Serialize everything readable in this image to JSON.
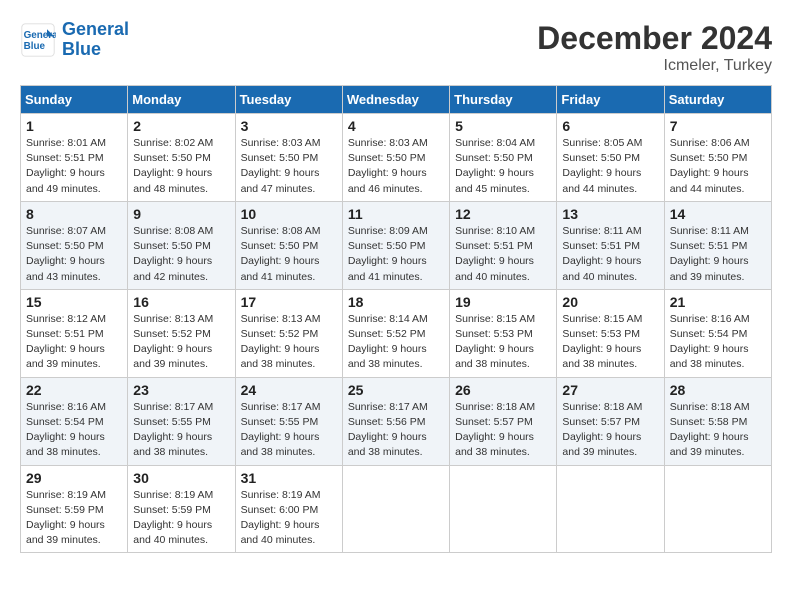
{
  "header": {
    "logo_line1": "General",
    "logo_line2": "Blue",
    "month": "December 2024",
    "location": "Icmeler, Turkey"
  },
  "weekdays": [
    "Sunday",
    "Monday",
    "Tuesday",
    "Wednesday",
    "Thursday",
    "Friday",
    "Saturday"
  ],
  "weeks": [
    [
      {
        "day": "1",
        "sunrise": "Sunrise: 8:01 AM",
        "sunset": "Sunset: 5:51 PM",
        "daylight": "Daylight: 9 hours and 49 minutes."
      },
      {
        "day": "2",
        "sunrise": "Sunrise: 8:02 AM",
        "sunset": "Sunset: 5:50 PM",
        "daylight": "Daylight: 9 hours and 48 minutes."
      },
      {
        "day": "3",
        "sunrise": "Sunrise: 8:03 AM",
        "sunset": "Sunset: 5:50 PM",
        "daylight": "Daylight: 9 hours and 47 minutes."
      },
      {
        "day": "4",
        "sunrise": "Sunrise: 8:03 AM",
        "sunset": "Sunset: 5:50 PM",
        "daylight": "Daylight: 9 hours and 46 minutes."
      },
      {
        "day": "5",
        "sunrise": "Sunrise: 8:04 AM",
        "sunset": "Sunset: 5:50 PM",
        "daylight": "Daylight: 9 hours and 45 minutes."
      },
      {
        "day": "6",
        "sunrise": "Sunrise: 8:05 AM",
        "sunset": "Sunset: 5:50 PM",
        "daylight": "Daylight: 9 hours and 44 minutes."
      },
      {
        "day": "7",
        "sunrise": "Sunrise: 8:06 AM",
        "sunset": "Sunset: 5:50 PM",
        "daylight": "Daylight: 9 hours and 44 minutes."
      }
    ],
    [
      {
        "day": "8",
        "sunrise": "Sunrise: 8:07 AM",
        "sunset": "Sunset: 5:50 PM",
        "daylight": "Daylight: 9 hours and 43 minutes."
      },
      {
        "day": "9",
        "sunrise": "Sunrise: 8:08 AM",
        "sunset": "Sunset: 5:50 PM",
        "daylight": "Daylight: 9 hours and 42 minutes."
      },
      {
        "day": "10",
        "sunrise": "Sunrise: 8:08 AM",
        "sunset": "Sunset: 5:50 PM",
        "daylight": "Daylight: 9 hours and 41 minutes."
      },
      {
        "day": "11",
        "sunrise": "Sunrise: 8:09 AM",
        "sunset": "Sunset: 5:50 PM",
        "daylight": "Daylight: 9 hours and 41 minutes."
      },
      {
        "day": "12",
        "sunrise": "Sunrise: 8:10 AM",
        "sunset": "Sunset: 5:51 PM",
        "daylight": "Daylight: 9 hours and 40 minutes."
      },
      {
        "day": "13",
        "sunrise": "Sunrise: 8:11 AM",
        "sunset": "Sunset: 5:51 PM",
        "daylight": "Daylight: 9 hours and 40 minutes."
      },
      {
        "day": "14",
        "sunrise": "Sunrise: 8:11 AM",
        "sunset": "Sunset: 5:51 PM",
        "daylight": "Daylight: 9 hours and 39 minutes."
      }
    ],
    [
      {
        "day": "15",
        "sunrise": "Sunrise: 8:12 AM",
        "sunset": "Sunset: 5:51 PM",
        "daylight": "Daylight: 9 hours and 39 minutes."
      },
      {
        "day": "16",
        "sunrise": "Sunrise: 8:13 AM",
        "sunset": "Sunset: 5:52 PM",
        "daylight": "Daylight: 9 hours and 39 minutes."
      },
      {
        "day": "17",
        "sunrise": "Sunrise: 8:13 AM",
        "sunset": "Sunset: 5:52 PM",
        "daylight": "Daylight: 9 hours and 38 minutes."
      },
      {
        "day": "18",
        "sunrise": "Sunrise: 8:14 AM",
        "sunset": "Sunset: 5:52 PM",
        "daylight": "Daylight: 9 hours and 38 minutes."
      },
      {
        "day": "19",
        "sunrise": "Sunrise: 8:15 AM",
        "sunset": "Sunset: 5:53 PM",
        "daylight": "Daylight: 9 hours and 38 minutes."
      },
      {
        "day": "20",
        "sunrise": "Sunrise: 8:15 AM",
        "sunset": "Sunset: 5:53 PM",
        "daylight": "Daylight: 9 hours and 38 minutes."
      },
      {
        "day": "21",
        "sunrise": "Sunrise: 8:16 AM",
        "sunset": "Sunset: 5:54 PM",
        "daylight": "Daylight: 9 hours and 38 minutes."
      }
    ],
    [
      {
        "day": "22",
        "sunrise": "Sunrise: 8:16 AM",
        "sunset": "Sunset: 5:54 PM",
        "daylight": "Daylight: 9 hours and 38 minutes."
      },
      {
        "day": "23",
        "sunrise": "Sunrise: 8:17 AM",
        "sunset": "Sunset: 5:55 PM",
        "daylight": "Daylight: 9 hours and 38 minutes."
      },
      {
        "day": "24",
        "sunrise": "Sunrise: 8:17 AM",
        "sunset": "Sunset: 5:55 PM",
        "daylight": "Daylight: 9 hours and 38 minutes."
      },
      {
        "day": "25",
        "sunrise": "Sunrise: 8:17 AM",
        "sunset": "Sunset: 5:56 PM",
        "daylight": "Daylight: 9 hours and 38 minutes."
      },
      {
        "day": "26",
        "sunrise": "Sunrise: 8:18 AM",
        "sunset": "Sunset: 5:57 PM",
        "daylight": "Daylight: 9 hours and 38 minutes."
      },
      {
        "day": "27",
        "sunrise": "Sunrise: 8:18 AM",
        "sunset": "Sunset: 5:57 PM",
        "daylight": "Daylight: 9 hours and 39 minutes."
      },
      {
        "day": "28",
        "sunrise": "Sunrise: 8:18 AM",
        "sunset": "Sunset: 5:58 PM",
        "daylight": "Daylight: 9 hours and 39 minutes."
      }
    ],
    [
      {
        "day": "29",
        "sunrise": "Sunrise: 8:19 AM",
        "sunset": "Sunset: 5:59 PM",
        "daylight": "Daylight: 9 hours and 39 minutes."
      },
      {
        "day": "30",
        "sunrise": "Sunrise: 8:19 AM",
        "sunset": "Sunset: 5:59 PM",
        "daylight": "Daylight: 9 hours and 40 minutes."
      },
      {
        "day": "31",
        "sunrise": "Sunrise: 8:19 AM",
        "sunset": "Sunset: 6:00 PM",
        "daylight": "Daylight: 9 hours and 40 minutes."
      },
      null,
      null,
      null,
      null
    ]
  ]
}
